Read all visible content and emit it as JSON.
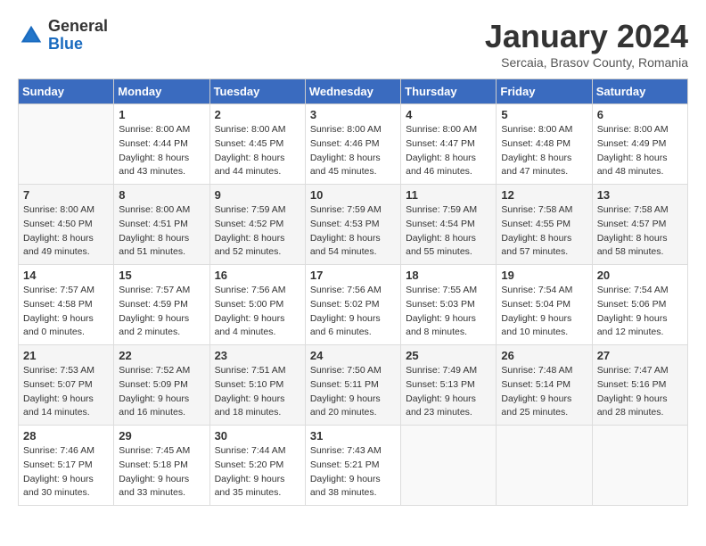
{
  "logo": {
    "general": "General",
    "blue": "Blue"
  },
  "title": "January 2024",
  "location": "Sercaia, Brasov County, Romania",
  "days_of_week": [
    "Sunday",
    "Monday",
    "Tuesday",
    "Wednesday",
    "Thursday",
    "Friday",
    "Saturday"
  ],
  "weeks": [
    [
      {
        "day": "",
        "info": ""
      },
      {
        "day": "1",
        "info": "Sunrise: 8:00 AM\nSunset: 4:44 PM\nDaylight: 8 hours\nand 43 minutes."
      },
      {
        "day": "2",
        "info": "Sunrise: 8:00 AM\nSunset: 4:45 PM\nDaylight: 8 hours\nand 44 minutes."
      },
      {
        "day": "3",
        "info": "Sunrise: 8:00 AM\nSunset: 4:46 PM\nDaylight: 8 hours\nand 45 minutes."
      },
      {
        "day": "4",
        "info": "Sunrise: 8:00 AM\nSunset: 4:47 PM\nDaylight: 8 hours\nand 46 minutes."
      },
      {
        "day": "5",
        "info": "Sunrise: 8:00 AM\nSunset: 4:48 PM\nDaylight: 8 hours\nand 47 minutes."
      },
      {
        "day": "6",
        "info": "Sunrise: 8:00 AM\nSunset: 4:49 PM\nDaylight: 8 hours\nand 48 minutes."
      }
    ],
    [
      {
        "day": "7",
        "info": "Sunrise: 8:00 AM\nSunset: 4:50 PM\nDaylight: 8 hours\nand 49 minutes."
      },
      {
        "day": "8",
        "info": "Sunrise: 8:00 AM\nSunset: 4:51 PM\nDaylight: 8 hours\nand 51 minutes."
      },
      {
        "day": "9",
        "info": "Sunrise: 7:59 AM\nSunset: 4:52 PM\nDaylight: 8 hours\nand 52 minutes."
      },
      {
        "day": "10",
        "info": "Sunrise: 7:59 AM\nSunset: 4:53 PM\nDaylight: 8 hours\nand 54 minutes."
      },
      {
        "day": "11",
        "info": "Sunrise: 7:59 AM\nSunset: 4:54 PM\nDaylight: 8 hours\nand 55 minutes."
      },
      {
        "day": "12",
        "info": "Sunrise: 7:58 AM\nSunset: 4:55 PM\nDaylight: 8 hours\nand 57 minutes."
      },
      {
        "day": "13",
        "info": "Sunrise: 7:58 AM\nSunset: 4:57 PM\nDaylight: 8 hours\nand 58 minutes."
      }
    ],
    [
      {
        "day": "14",
        "info": "Sunrise: 7:57 AM\nSunset: 4:58 PM\nDaylight: 9 hours\nand 0 minutes."
      },
      {
        "day": "15",
        "info": "Sunrise: 7:57 AM\nSunset: 4:59 PM\nDaylight: 9 hours\nand 2 minutes."
      },
      {
        "day": "16",
        "info": "Sunrise: 7:56 AM\nSunset: 5:00 PM\nDaylight: 9 hours\nand 4 minutes."
      },
      {
        "day": "17",
        "info": "Sunrise: 7:56 AM\nSunset: 5:02 PM\nDaylight: 9 hours\nand 6 minutes."
      },
      {
        "day": "18",
        "info": "Sunrise: 7:55 AM\nSunset: 5:03 PM\nDaylight: 9 hours\nand 8 minutes."
      },
      {
        "day": "19",
        "info": "Sunrise: 7:54 AM\nSunset: 5:04 PM\nDaylight: 9 hours\nand 10 minutes."
      },
      {
        "day": "20",
        "info": "Sunrise: 7:54 AM\nSunset: 5:06 PM\nDaylight: 9 hours\nand 12 minutes."
      }
    ],
    [
      {
        "day": "21",
        "info": "Sunrise: 7:53 AM\nSunset: 5:07 PM\nDaylight: 9 hours\nand 14 minutes."
      },
      {
        "day": "22",
        "info": "Sunrise: 7:52 AM\nSunset: 5:09 PM\nDaylight: 9 hours\nand 16 minutes."
      },
      {
        "day": "23",
        "info": "Sunrise: 7:51 AM\nSunset: 5:10 PM\nDaylight: 9 hours\nand 18 minutes."
      },
      {
        "day": "24",
        "info": "Sunrise: 7:50 AM\nSunset: 5:11 PM\nDaylight: 9 hours\nand 20 minutes."
      },
      {
        "day": "25",
        "info": "Sunrise: 7:49 AM\nSunset: 5:13 PM\nDaylight: 9 hours\nand 23 minutes."
      },
      {
        "day": "26",
        "info": "Sunrise: 7:48 AM\nSunset: 5:14 PM\nDaylight: 9 hours\nand 25 minutes."
      },
      {
        "day": "27",
        "info": "Sunrise: 7:47 AM\nSunset: 5:16 PM\nDaylight: 9 hours\nand 28 minutes."
      }
    ],
    [
      {
        "day": "28",
        "info": "Sunrise: 7:46 AM\nSunset: 5:17 PM\nDaylight: 9 hours\nand 30 minutes."
      },
      {
        "day": "29",
        "info": "Sunrise: 7:45 AM\nSunset: 5:18 PM\nDaylight: 9 hours\nand 33 minutes."
      },
      {
        "day": "30",
        "info": "Sunrise: 7:44 AM\nSunset: 5:20 PM\nDaylight: 9 hours\nand 35 minutes."
      },
      {
        "day": "31",
        "info": "Sunrise: 7:43 AM\nSunset: 5:21 PM\nDaylight: 9 hours\nand 38 minutes."
      },
      {
        "day": "",
        "info": ""
      },
      {
        "day": "",
        "info": ""
      },
      {
        "day": "",
        "info": ""
      }
    ]
  ]
}
